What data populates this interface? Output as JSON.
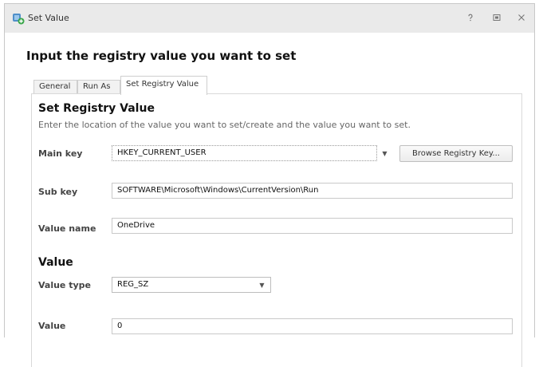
{
  "window": {
    "title": "Set Value",
    "controls": {
      "help": "help-icon",
      "restore": "restore-icon",
      "close": "close-icon"
    }
  },
  "dialog": {
    "heading": "Input the registry value you want to set",
    "tabs": [
      {
        "label": "General",
        "active": false
      },
      {
        "label": "Run As",
        "active": false
      },
      {
        "label": "Set Registry Value",
        "active": true
      }
    ]
  },
  "registry": {
    "section_title": "Set Registry Value",
    "description": "Enter the location of the value you want to set/create and the value you want to set.",
    "main_key": {
      "label": "Main key",
      "value": "HKEY_CURRENT_USER"
    },
    "browse_button": "Browse Registry Key...",
    "sub_key": {
      "label": "Sub key",
      "value": "SOFTWARE\\Microsoft\\Windows\\CurrentVersion\\Run"
    },
    "value_name": {
      "label": "Value name",
      "value": "OneDrive"
    }
  },
  "value_section": {
    "title": "Value",
    "value_type": {
      "label": "Value type",
      "value": "REG_SZ"
    },
    "value": {
      "label": "Value",
      "value": "0"
    }
  }
}
